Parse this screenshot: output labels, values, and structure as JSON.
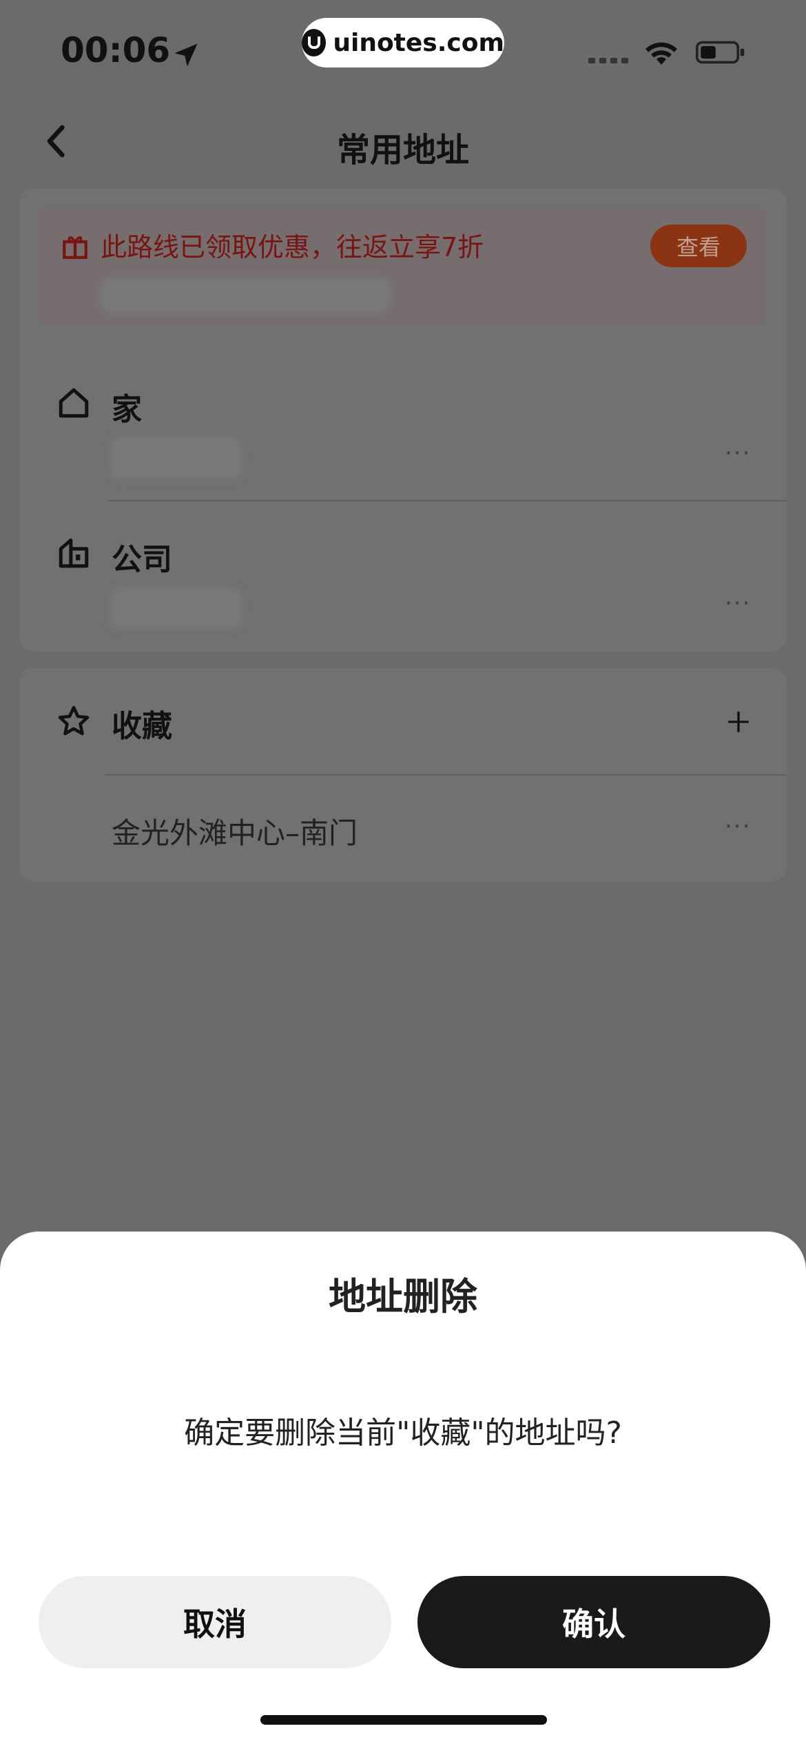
{
  "status_bar": {
    "time": "00:06",
    "watermark": "uinotes.com"
  },
  "nav": {
    "title": "常用地址"
  },
  "promo": {
    "text": "此路线已领取优惠，往返立享7折",
    "button": "查看"
  },
  "addresses": {
    "home": {
      "label": "家"
    },
    "work": {
      "label": "公司"
    }
  },
  "favorites": {
    "label": "收藏",
    "items": [
      {
        "name": "金光外滩中心–南门"
      }
    ]
  },
  "dialog": {
    "title": "地址删除",
    "message": "确定要删除当前\"收藏\"的地址吗?",
    "cancel_label": "取消",
    "confirm_label": "确认"
  },
  "icons": {
    "location": "location-arrow-icon",
    "wifi": "wifi-icon",
    "battery": "battery-icon",
    "back": "chevron-left-icon",
    "gift": "gift-icon",
    "home": "home-icon",
    "work": "building-icon",
    "star": "star-icon",
    "plus": "plus-icon",
    "more": "more-dots-icon"
  },
  "colors": {
    "accent": "#1a1a1a",
    "promo_text": "#7a1410",
    "promo_button": "#8b3413"
  }
}
